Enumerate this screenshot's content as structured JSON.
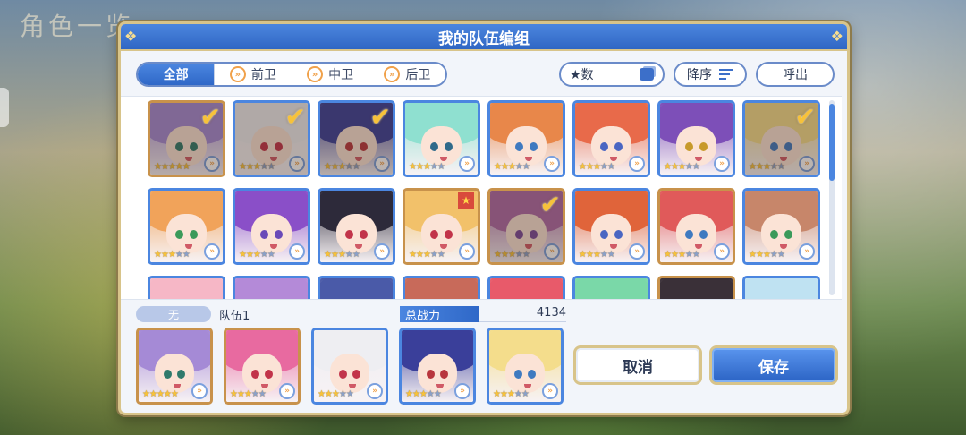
{
  "background": {
    "title": "角色一览"
  },
  "dialog": {
    "title": "我的队伍编组"
  },
  "filters": {
    "tabs": [
      {
        "label": "全部",
        "active": true,
        "icon": ""
      },
      {
        "label": "前卫",
        "active": false,
        "icon": "chevron-right-icon"
      },
      {
        "label": "中卫",
        "active": false,
        "icon": "chevron-right-icon"
      },
      {
        "label": "后卫",
        "active": false,
        "icon": "chevron-right-icon"
      }
    ],
    "sort_by": "★数",
    "sort_order": "降序",
    "call_out": "呼出"
  },
  "roster": [
    {
      "hair": "#a58ad6",
      "eye": "#2f7a6c",
      "stars": 5,
      "selected": true,
      "frame": "bronze"
    },
    {
      "hair": "#eeeef2",
      "eye": "#c2344a",
      "stars": 3,
      "selected": true,
      "frame": "blue"
    },
    {
      "hair": "#3a3f9a",
      "eye": "#b8363e",
      "stars": 3,
      "selected": true,
      "frame": "blue"
    },
    {
      "hair": "#8fe0d0",
      "eye": "#2f6a8a",
      "stars": 3,
      "selected": false,
      "frame": "blue"
    },
    {
      "hair": "#e8874a",
      "eye": "#3f7ac0",
      "stars": 3,
      "selected": false,
      "frame": "blue"
    },
    {
      "hair": "#e86a4a",
      "eye": "#4a66c2",
      "stars": 3,
      "selected": false,
      "frame": "blue"
    },
    {
      "hair": "#7d4fb8",
      "eye": "#c79a2b",
      "stars": 3,
      "selected": false,
      "frame": "blue"
    },
    {
      "hair": "#f4dd8c",
      "eye": "#3f7ac0",
      "stars": 3,
      "selected": true,
      "frame": "blue"
    },
    {
      "hair": "#f1a35a",
      "eye": "#3b9a5a",
      "stars": 3,
      "selected": false,
      "frame": "blue"
    },
    {
      "hair": "#8a4fc8",
      "eye": "#6a4ab8",
      "stars": 3,
      "selected": false,
      "frame": "blue"
    },
    {
      "hair": "#2d2a3a",
      "eye": "#c2344a",
      "stars": 3,
      "selected": false,
      "frame": "blue"
    },
    {
      "hair": "#f2c16a",
      "eye": "#c2344a",
      "stars": 3,
      "selected": false,
      "frame": "bronze",
      "rank": true
    },
    {
      "hair": "#b06aa8",
      "eye": "#7a4a9a",
      "stars": 3,
      "selected": true,
      "frame": "bronze"
    },
    {
      "hair": "#e0643a",
      "eye": "#4a66c2",
      "stars": 3,
      "selected": false,
      "frame": "blue"
    },
    {
      "hair": "#e05a5a",
      "eye": "#3f7ac0",
      "stars": 3,
      "selected": false,
      "frame": "bronze"
    },
    {
      "hair": "#c7866a",
      "eye": "#3b9a5a",
      "stars": 3,
      "selected": false,
      "frame": "blue"
    },
    {
      "hair": "#f6b7c6",
      "eye": "#c2344a",
      "stars": 3,
      "selected": false,
      "frame": "blue"
    },
    {
      "hair": "#b48ad8",
      "eye": "#6a4ab8",
      "stars": 3,
      "selected": false,
      "frame": "blue"
    },
    {
      "hair": "#4a5aa8",
      "eye": "#c79a2b",
      "stars": 3,
      "selected": false,
      "frame": "blue"
    },
    {
      "hair": "#c86a5a",
      "eye": "#3f7ac0",
      "stars": 3,
      "selected": false,
      "frame": "blue"
    },
    {
      "hair": "#e85a6a",
      "eye": "#3f7ac0",
      "stars": 3,
      "selected": false,
      "frame": "blue"
    },
    {
      "hair": "#7ad8a8",
      "eye": "#2f6a8a",
      "stars": 3,
      "selected": false,
      "frame": "blue"
    },
    {
      "hair": "#3a3038",
      "eye": "#c2344a",
      "stars": 3,
      "selected": false,
      "frame": "bronze"
    },
    {
      "hair": "#bfe2f2",
      "eye": "#3f7ac0",
      "stars": 3,
      "selected": false,
      "frame": "blue"
    }
  ],
  "team": {
    "label": "无",
    "name": "队伍1",
    "power_label": "总战力",
    "power": "4134",
    "members": [
      {
        "hair": "#a58ad6",
        "eye": "#2f7a6c",
        "stars": 5,
        "frame": "bronze"
      },
      {
        "hair": "#e86aa0",
        "eye": "#c2344a",
        "stars": 3,
        "frame": "bronze"
      },
      {
        "hair": "#eeeef2",
        "eye": "#c2344a",
        "stars": 3,
        "frame": "blue"
      },
      {
        "hair": "#3a3f9a",
        "eye": "#b8363e",
        "stars": 3,
        "frame": "blue"
      },
      {
        "hair": "#f4dd8c",
        "eye": "#3f7ac0",
        "stars": 3,
        "frame": "blue"
      }
    ]
  },
  "actions": {
    "cancel": "取消",
    "save": "保存"
  },
  "symbols": {
    "check": "✔",
    "arrow": "»",
    "star": "★",
    "rank": "★",
    "ornament": "❖"
  }
}
